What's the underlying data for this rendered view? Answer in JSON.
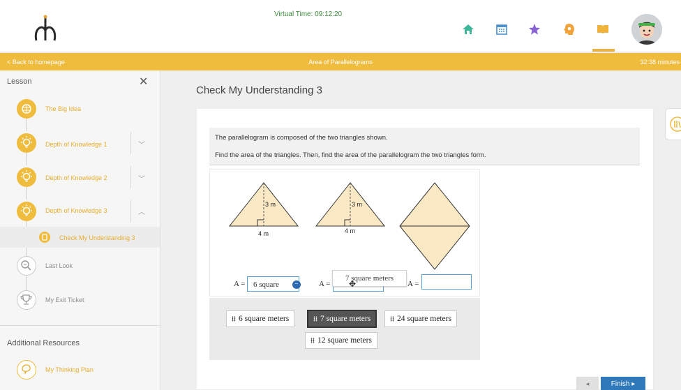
{
  "header": {
    "virtual_time": "Virtual Time: 09:12:20",
    "nav_icons": [
      "home-icon",
      "calendar-icon",
      "star-icon",
      "head-gear-icon",
      "book-icon"
    ]
  },
  "yellow_bar": {
    "back": "< Back to homepage",
    "title": "Area of Parallelograms",
    "timer": "32:38 minutes"
  },
  "sidebar": {
    "heading": "Lesson",
    "close": "✕",
    "items": [
      {
        "label": "The Big Idea"
      },
      {
        "label": "Depth of Knowledge 1"
      },
      {
        "label": "Depth of Knowledge 2"
      },
      {
        "label": "Depth of Knowledge 3"
      },
      {
        "label": "Check My Understanding 3"
      },
      {
        "label": "Last Look"
      },
      {
        "label": "My Exit Ticket"
      }
    ],
    "additional_heading": "Additional Resources",
    "resources": [
      {
        "label": "My Thinking Plan"
      }
    ]
  },
  "main": {
    "title": "Check My Understanding 3",
    "prompt_line1": "The parallelogram is composed of the two triangles shown.",
    "prompt_line2": "Find the area of the triangles. Then, find the area of the parallelogram the two triangles form.",
    "figures": {
      "height_label": "3 m",
      "base_label": "4 m"
    },
    "answers": [
      {
        "label": "A =",
        "value": "6 square"
      },
      {
        "label": "A =",
        "value": ""
      },
      {
        "label": "A =",
        "value": ""
      }
    ],
    "dragging_chip": "7 square meters",
    "bank": [
      "6 square meters",
      "7 square meters",
      "24 square meters",
      "12 square meters"
    ],
    "prev_button": "◂",
    "finish_button": "Finish ▸"
  },
  "colors": {
    "accent": "#efbc3e",
    "triangle_fill": "#fbe9c6",
    "primary_button": "#2f79bb"
  }
}
